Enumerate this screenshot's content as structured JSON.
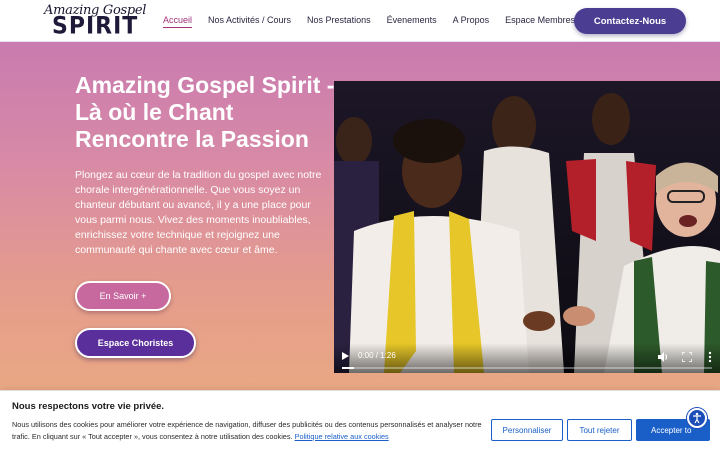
{
  "logo": {
    "line1": "Amazing Gospel",
    "line2": "SPIRIT"
  },
  "nav": {
    "items": [
      {
        "label": "Accueil",
        "active": true
      },
      {
        "label": "Nos Activités / Cours",
        "active": false
      },
      {
        "label": "Nos Prestations",
        "active": false
      },
      {
        "label": "Évenements",
        "active": false
      },
      {
        "label": "A Propos",
        "active": false
      },
      {
        "label": "Espace Membres",
        "active": false
      }
    ],
    "contact_label": "Contactez-Nous"
  },
  "hero": {
    "title": "Amazing Gospel Spirit - Là où le Chant Rencontre la Passion",
    "text": "Plongez au cœur de la tradition du gospel avec notre chorale intergénérationnelle. Que vous soyez un chanteur débutant ou avancé, il y a une place pour vous parmi nous. Vivez des moments inoubliables, enrichissez votre technique et rejoignez une communauté qui chante avec cœur et âme.",
    "btn_savoir": "En Savoir +",
    "btn_choristes": "Espace Choristes"
  },
  "video": {
    "time": "0:00 / 1:26",
    "progress": 0.0
  },
  "cookie": {
    "title": "Nous respectons votre vie privée.",
    "text": "Nous utilisons des cookies pour améliorer votre expérience de navigation, diffuser des publicités ou des contenus personnalisés et analyser notre trafic. En cliquant sur « Tout accepter », vous consentez à notre utilisation des cookies.",
    "link": "Politique relative aux cookies",
    "btn_customize": "Personnaliser",
    "btn_reject": "Tout rejeter",
    "btn_accept": "Accepter to"
  },
  "colors": {
    "brand_purple": "#4b3d92",
    "active_nav": "#a0327a",
    "cookie_blue": "#1a5fc8"
  }
}
